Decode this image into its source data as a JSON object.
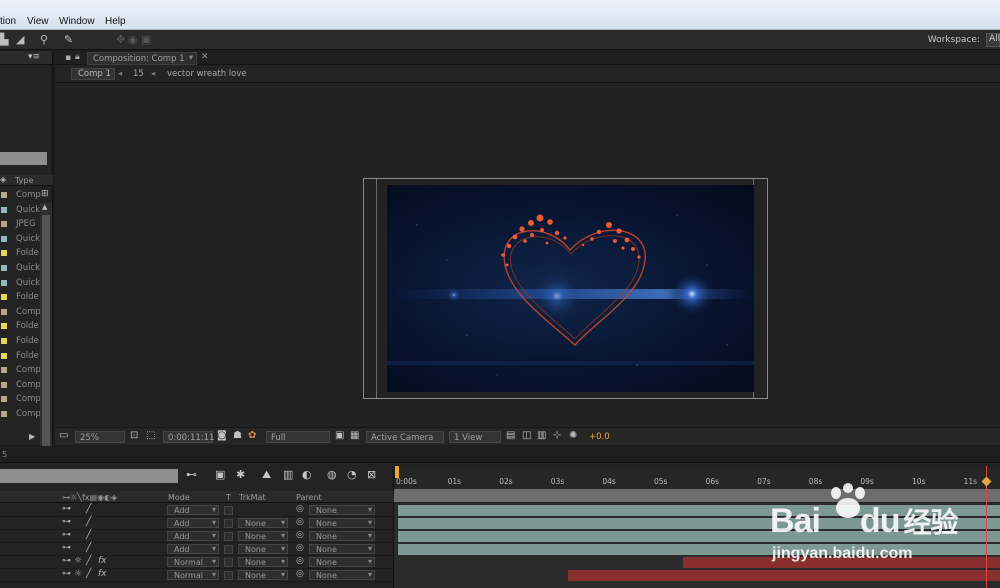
{
  "menubar": {
    "items": [
      "tion",
      "View",
      "Window",
      "Help"
    ]
  },
  "toolbar": {
    "workspace_label": "Workspace:",
    "workspace_value": "All"
  },
  "project": {
    "column_type": "Type",
    "rows": [
      {
        "type": "Comp",
        "color": "#b7a889"
      },
      {
        "type": "Quick",
        "color": "#8fb9c0"
      },
      {
        "type": "JPEG",
        "color": "#b7a889"
      },
      {
        "type": "Quick",
        "color": "#8fb9c0"
      },
      {
        "type": "Folde",
        "color": "#e5d84f"
      },
      {
        "type": "Quick",
        "color": "#8fb9c0"
      },
      {
        "type": "Quick",
        "color": "#8fb9c0"
      },
      {
        "type": "Folde",
        "color": "#e5d84f"
      },
      {
        "type": "Comp",
        "color": "#b7a889"
      },
      {
        "type": "Folde",
        "color": "#e5d84f"
      },
      {
        "type": "Folde",
        "color": "#e5d84f"
      },
      {
        "type": "Folde",
        "color": "#e5d84f"
      },
      {
        "type": "Comp",
        "color": "#b7a889"
      },
      {
        "type": "Comp",
        "color": "#b7a889"
      },
      {
        "type": "Comp",
        "color": "#b7a889"
      },
      {
        "type": "Comp",
        "color": "#b7a889"
      }
    ]
  },
  "composition": {
    "tab_label": "Composition: Comp 1",
    "breadcrumb": {
      "comp": "Comp 1",
      "number": "15",
      "layer": "vector wreath love"
    },
    "controls": {
      "zoom": "25%",
      "timecode": "0:00:11:11",
      "resolution": "Full",
      "camera": "Active Camera",
      "views": "1 View",
      "exposure": "+0.0"
    }
  },
  "timeline": {
    "columns": {
      "mode": "Mode",
      "t": "T",
      "trkmat": "TrkMat",
      "parent": "Parent"
    },
    "ticks": [
      "0:00s",
      "01s",
      "02s",
      "03s",
      "04s",
      "05s",
      "06s",
      "07s",
      "08s",
      "09s",
      "10s",
      "11s"
    ],
    "layers": [
      {
        "mode": "Add",
        "trkmat": "",
        "parent": "None",
        "fx": false
      },
      {
        "mode": "Add",
        "trkmat": "None",
        "parent": "None",
        "fx": false
      },
      {
        "mode": "Add",
        "trkmat": "None",
        "parent": "None",
        "fx": false
      },
      {
        "mode": "Add",
        "trkmat": "None",
        "parent": "None",
        "fx": false
      },
      {
        "mode": "Normal",
        "trkmat": "None",
        "parent": "None",
        "fx": true
      },
      {
        "mode": "Normal",
        "trkmat": "None",
        "parent": "None",
        "fx": true
      }
    ],
    "bars": [
      {
        "start": 0.0,
        "end": 1.0,
        "color": "#7d9893"
      },
      {
        "start": 0.0,
        "end": 1.0,
        "color": "#7d9893"
      },
      {
        "start": 0.0,
        "end": 1.0,
        "color": "#7d9893"
      },
      {
        "start": 0.0,
        "end": 1.0,
        "color": "#7d9893"
      },
      {
        "start": 0.47,
        "end": 1.0,
        "color": "#8a2f2f"
      },
      {
        "start": 0.28,
        "end": 1.0,
        "color": "#8a2f2f"
      }
    ]
  },
  "watermark": {
    "logo_text": "Bai",
    "logo_suffix": "du",
    "logo_cn": "经验",
    "url": "jingyan.baidu.com"
  }
}
